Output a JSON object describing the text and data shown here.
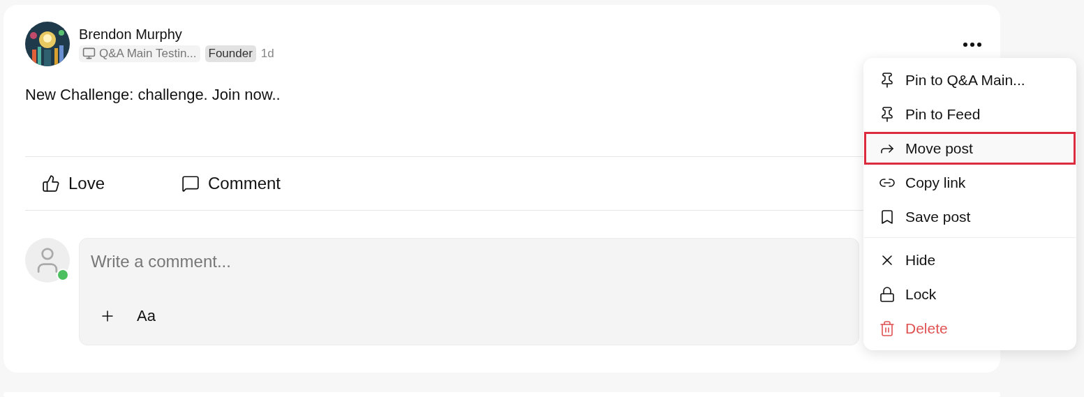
{
  "post": {
    "author": "Brendon Murphy",
    "space": "Q&A Main Testin...",
    "role": "Founder",
    "time": "1d",
    "body": "New Challenge: challenge. Join now..",
    "actions": [
      "Love",
      "Comment"
    ],
    "comment": {
      "placeholder": "Write a comment...",
      "online": true,
      "format_label": "Aa"
    }
  },
  "menu": {
    "groups": [
      [
        {
          "label": "Pin to Q&A Main...",
          "highlighted": false,
          "kind": "normal"
        },
        {
          "label": "Pin to Feed",
          "highlighted": false,
          "kind": "normal"
        },
        {
          "label": "Move post",
          "highlighted": true,
          "kind": "normal"
        },
        {
          "label": "Copy link",
          "highlighted": false,
          "kind": "normal"
        },
        {
          "label": "Save post",
          "highlighted": false,
          "kind": "normal"
        }
      ],
      [
        {
          "label": "Hide",
          "highlighted": false,
          "kind": "normal"
        },
        {
          "label": "Lock",
          "highlighted": false,
          "kind": "normal"
        },
        {
          "label": "Delete",
          "highlighted": false,
          "kind": "danger"
        }
      ]
    ]
  }
}
